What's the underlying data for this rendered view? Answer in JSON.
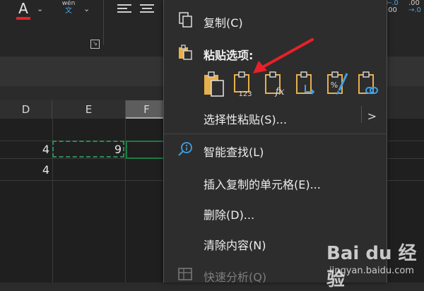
{
  "ribbon": {
    "font_color_label": "A",
    "phonetic_pinyin": "wén",
    "phonetic_char": "文",
    "decimal_increase_top": "←.0",
    "decimal_increase_bottom": ".00",
    "decimal_decrease_top": ".00",
    "decimal_decrease_bottom": "→.0"
  },
  "sheet": {
    "columns": [
      {
        "label": "D"
      },
      {
        "label": "E"
      },
      {
        "label": "F"
      }
    ],
    "cells": {
      "d_row1": "4",
      "e_row1": "9",
      "d_row2": "4"
    }
  },
  "context_menu": {
    "copy": "复制(C)",
    "paste_options_header": "粘贴选项:",
    "paste_special": "选择性粘贴(S)...",
    "smart_lookup": "智能查找(L)",
    "insert_copied_cells": "插入复制的单元格(E)...",
    "delete": "删除(D)...",
    "clear_contents": "清除内容(N)",
    "quick_analysis": "快速分析(Q)",
    "paste_buttons": [
      {
        "name": "paste-icon",
        "caption": ""
      },
      {
        "name": "paste-values-icon",
        "caption": "123"
      },
      {
        "name": "paste-formulas-icon",
        "caption": "fx"
      },
      {
        "name": "paste-transpose-icon",
        "caption": ""
      },
      {
        "name": "paste-formatting-icon",
        "caption": "%"
      },
      {
        "name": "paste-link-icon",
        "caption": ""
      }
    ]
  },
  "colors": {
    "accent_red": "#e8202a",
    "excel_green": "#1f7a46",
    "menu_bg": "#2d2d2d",
    "icon_gold": "#e8b04b",
    "icon_blue": "#3fa0e6"
  },
  "watermark": {
    "logo": "Bai du 经验",
    "url": "jingyan.baidu.com"
  }
}
